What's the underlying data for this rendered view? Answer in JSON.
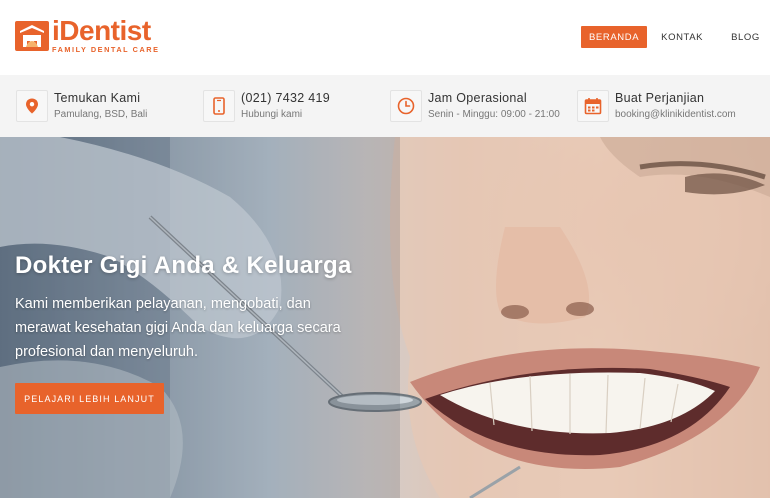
{
  "header": {
    "logo": {
      "word": "iDentist",
      "tagline": "FAMILY DENTAL CARE"
    },
    "nav": [
      {
        "label": "BERANDA",
        "active": true
      },
      {
        "label": "KONTAK",
        "active": false
      },
      {
        "label": "BLOG",
        "active": false
      }
    ]
  },
  "infobar": {
    "items": [
      {
        "icon": "location-pin-icon",
        "title": "Temukan Kami",
        "subtitle": "Pamulang, BSD, Bali"
      },
      {
        "icon": "phone-icon",
        "title": "(021) 7432 419",
        "subtitle": "Hubungi kami"
      },
      {
        "icon": "clock-icon",
        "title": "Jam Operasional",
        "subtitle": "Senin - Minggu: 09:00 - 21:00"
      },
      {
        "icon": "calendar-icon",
        "title": "Buat Perjanjian",
        "subtitle": "booking@klinikidentist.com"
      }
    ]
  },
  "hero": {
    "title": "Dokter Gigi Anda & Keluarga",
    "text": "Kami memberikan pelayanan, mengobati, dan merawat kesehatan gigi Anda dan keluarga secara profesional dan menyeluruh.",
    "button_label": "PELAJARI LEBIH LANJUT"
  },
  "colors": {
    "accent": "#e8632b",
    "infobar_bg": "#f4f4f4",
    "text": "#333333",
    "muted": "#777777"
  }
}
